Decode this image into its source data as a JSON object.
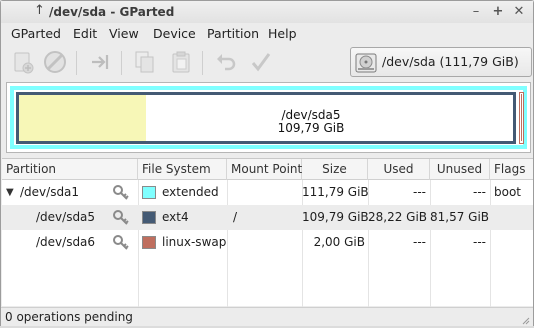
{
  "window": {
    "title": "/dev/sda - GParted",
    "title_icon": "up-arrow-icon",
    "controls": [
      "minimize-icon",
      "maximize-icon",
      "close-icon"
    ]
  },
  "menubar": [
    "GParted",
    "Edit",
    "View",
    "Device",
    "Partition",
    "Help"
  ],
  "toolbar": {
    "buttons": [
      {
        "icon": "new-partition-icon",
        "enabled": false
      },
      {
        "icon": "delete-icon",
        "enabled": false
      },
      {
        "icon": "resize-move-icon",
        "enabled": false
      },
      {
        "icon": "copy-icon",
        "enabled": false
      },
      {
        "icon": "paste-icon",
        "enabled": false
      },
      {
        "icon": "undo-icon",
        "enabled": false
      },
      {
        "icon": "apply-icon",
        "enabled": false
      }
    ]
  },
  "device_selector": {
    "icon": "hard-disk-icon",
    "label": "/dev/sda  (111,79 GiB)"
  },
  "disk_map": {
    "colors": {
      "extended": "#7fffff",
      "ext4": "#445a74",
      "linux_swap": "#bf6e5e",
      "used": "#f7f7b7"
    },
    "sda5": {
      "name": "/dev/sda5",
      "size": "109,79 GiB",
      "used_fraction": 0.257
    },
    "sda6": {
      "name": "/dev/sda6"
    }
  },
  "table": {
    "headers": [
      "Partition",
      "File System",
      "Mount Point",
      "Size",
      "Used",
      "Unused",
      "Flags"
    ],
    "rows": [
      {
        "partition": "/dev/sda1",
        "fs": "extended",
        "fs_color": "#7fffff",
        "mount": "",
        "size": "111,79 GiB",
        "used": "---",
        "unused": "---",
        "flags": "boot",
        "expanded": true
      },
      {
        "partition": "/dev/sda5",
        "fs": "ext4",
        "fs_color": "#445a74",
        "mount": "/",
        "size": "109,79 GiB",
        "used": "28,22 GiB",
        "unused": "81,57 GiB",
        "flags": ""
      },
      {
        "partition": "/dev/sda6",
        "fs": "linux-swap",
        "fs_color": "#bf6e5e",
        "mount": "",
        "size": "2,00 GiB",
        "used": "---",
        "unused": "---",
        "flags": ""
      }
    ]
  },
  "statusbar": {
    "text": "0 operations pending"
  }
}
